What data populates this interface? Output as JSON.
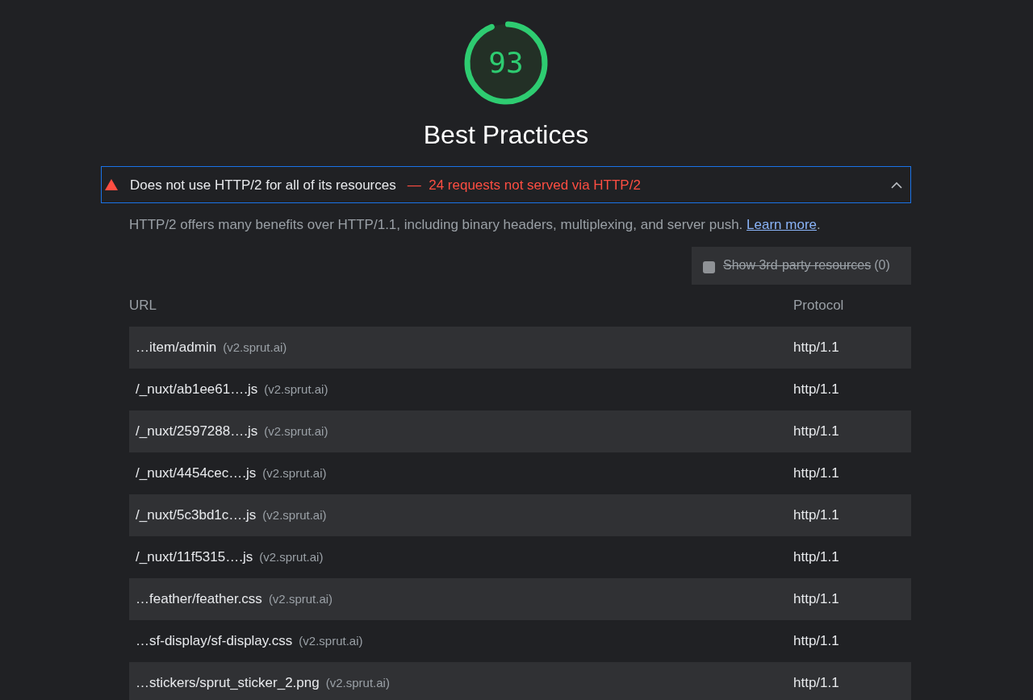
{
  "gauge": {
    "score": "93",
    "level": 0.93,
    "title": "Best Practices"
  },
  "audit": {
    "title": "Does not use HTTP/2 for all of its resources",
    "separator": "—",
    "summary": "24 requests not served via HTTP/2",
    "expanded": true,
    "description": "HTTP/2 offers many benefits over HTTP/1.1, including binary headers, multiplexing, and server push. ",
    "link": "Learn more",
    "after_link": ".",
    "filter": {
      "label": "Show 3rd-party resources",
      "count": "(0)",
      "checked": false,
      "disabled": true
    },
    "table": {
      "columns": [
        "URL",
        "Protocol"
      ],
      "rows": [
        {
          "url": "…item/admin",
          "host": "(v2.sprut.ai)",
          "protocol": "http/1.1"
        },
        {
          "url": "/_nuxt/ab1ee61….js",
          "host": "(v2.sprut.ai)",
          "protocol": "http/1.1"
        },
        {
          "url": "/_nuxt/2597288….js",
          "host": "(v2.sprut.ai)",
          "protocol": "http/1.1"
        },
        {
          "url": "/_nuxt/4454cec….js",
          "host": "(v2.sprut.ai)",
          "protocol": "http/1.1"
        },
        {
          "url": "/_nuxt/5c3bd1c….js",
          "host": "(v2.sprut.ai)",
          "protocol": "http/1.1"
        },
        {
          "url": "/_nuxt/11f5315….js",
          "host": "(v2.sprut.ai)",
          "protocol": "http/1.1"
        },
        {
          "url": "…feather/feather.css",
          "host": "(v2.sprut.ai)",
          "protocol": "http/1.1"
        },
        {
          "url": "…sf-display/sf-display.css",
          "host": "(v2.sprut.ai)",
          "protocol": "http/1.1"
        },
        {
          "url": "…stickers/sprut_sticker_2.png",
          "host": "(v2.sprut.ai)",
          "protocol": "http/1.1"
        }
      ]
    }
  }
}
